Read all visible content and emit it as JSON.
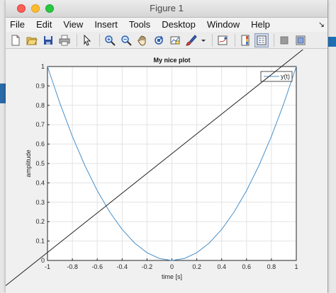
{
  "window": {
    "title": "Figure 1"
  },
  "menu": [
    "File",
    "Edit",
    "View",
    "Insert",
    "Tools",
    "Desktop",
    "Window",
    "Help"
  ],
  "toolbar": [
    "new-figure-icon",
    "open-file-icon",
    "save-icon",
    "print-icon",
    "pointer-icon",
    "zoom-in-icon",
    "zoom-out-icon",
    "pan-hand-icon",
    "rotate-3d-icon",
    "data-cursor-icon",
    "brush-icon",
    "link-plot-icon",
    "colorbar-icon",
    "legend-icon",
    "hide-plot-tools-icon",
    "show-plot-tools-icon"
  ],
  "colors": {
    "curve": "#4a90c8",
    "line": "#222222",
    "grid": "#e3e3e3"
  },
  "chart_data": {
    "type": "line",
    "title": "My nice plot",
    "xlabel": "time [s]",
    "ylabel": "amplitude",
    "xlim": [
      -1,
      1
    ],
    "ylim": [
      0,
      1
    ],
    "xticks": [
      "-1",
      "-0.8",
      "-0.6",
      "-0.4",
      "-0.2",
      "0",
      "0.2",
      "0.4",
      "0.6",
      "0.8",
      "1"
    ],
    "yticks": [
      "0",
      "0.1",
      "0.2",
      "0.3",
      "0.4",
      "0.5",
      "0.6",
      "0.7",
      "0.8",
      "0.9",
      "1"
    ],
    "grid": true,
    "legend": {
      "placement": "top-right",
      "entries": [
        "y(t)"
      ]
    },
    "series": [
      {
        "name": "y(t)",
        "x": [
          -1,
          -0.9,
          -0.8,
          -0.7,
          -0.6,
          -0.5,
          -0.4,
          -0.3,
          -0.2,
          -0.1,
          0,
          0.1,
          0.2,
          0.3,
          0.4,
          0.5,
          0.6,
          0.7,
          0.8,
          0.9,
          1
        ],
        "y": [
          1,
          0.81,
          0.64,
          0.49,
          0.36,
          0.25,
          0.16,
          0.09,
          0.04,
          0.01,
          0,
          0.01,
          0.04,
          0.09,
          0.16,
          0.25,
          0.36,
          0.49,
          0.64,
          0.81,
          1
        ]
      }
    ]
  }
}
